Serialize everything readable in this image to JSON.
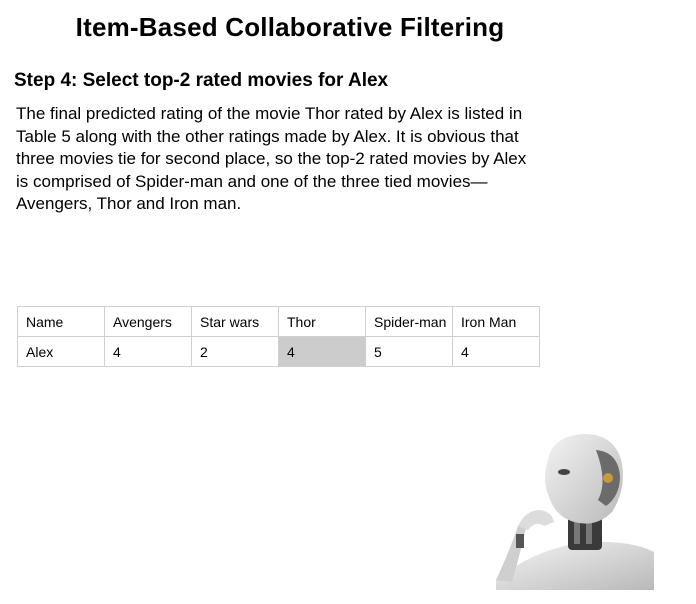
{
  "title": "Item-Based Collaborative Filtering",
  "step_heading": "Step 4: Select top-2 rated movies for Alex",
  "paragraph": "The final predicted rating of the movie Thor rated by Alex is listed in Table 5 along with the other ratings made by Alex. It is obvious that three movies tie for second place, so the top-2 rated movies by Alex is comprised of Spider-man and one of the three tied movies—Avengers, Thor and Iron man.",
  "table": {
    "headers": [
      "Name",
      "Avengers",
      "Star wars",
      "Thor",
      "Spider-man",
      "Iron Man"
    ],
    "rows": [
      [
        "Alex",
        "4",
        "2",
        "4",
        "5",
        "4"
      ]
    ],
    "highlight_color": "#cccccc"
  },
  "image": {
    "icon": "robot-thinking-icon"
  }
}
